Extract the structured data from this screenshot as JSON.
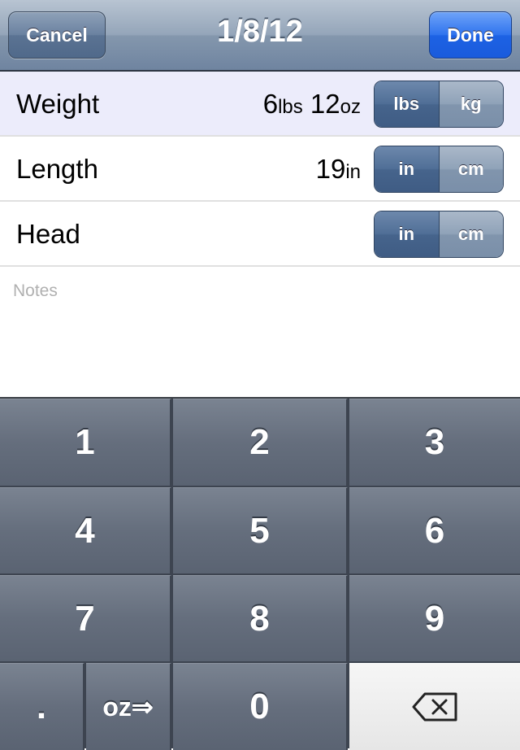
{
  "navbar": {
    "title": "1/8/12",
    "cancel_label": "Cancel",
    "done_label": "Done"
  },
  "rows": [
    {
      "label": "Weight",
      "value_parts": [
        {
          "num": "6",
          "unit": "lbs"
        },
        {
          "num": "12",
          "unit": "oz"
        }
      ],
      "units": [
        "lbs",
        "kg"
      ],
      "selected_unit": "lbs"
    },
    {
      "label": "Length",
      "value_parts": [
        {
          "num": "19",
          "unit": "in"
        }
      ],
      "units": [
        "in",
        "cm"
      ],
      "selected_unit": "in"
    },
    {
      "label": "Head",
      "value_parts": [],
      "units": [
        "in",
        "cm"
      ],
      "selected_unit": "in"
    }
  ],
  "notes": {
    "placeholder": "Notes"
  },
  "keypad": {
    "keys": [
      "1",
      "2",
      "3",
      "4",
      "5",
      "6",
      "7",
      "8",
      "9"
    ],
    "dot": ".",
    "oz_toggle": "oz⇒",
    "zero": "0",
    "delete_icon": "backspace-icon"
  }
}
